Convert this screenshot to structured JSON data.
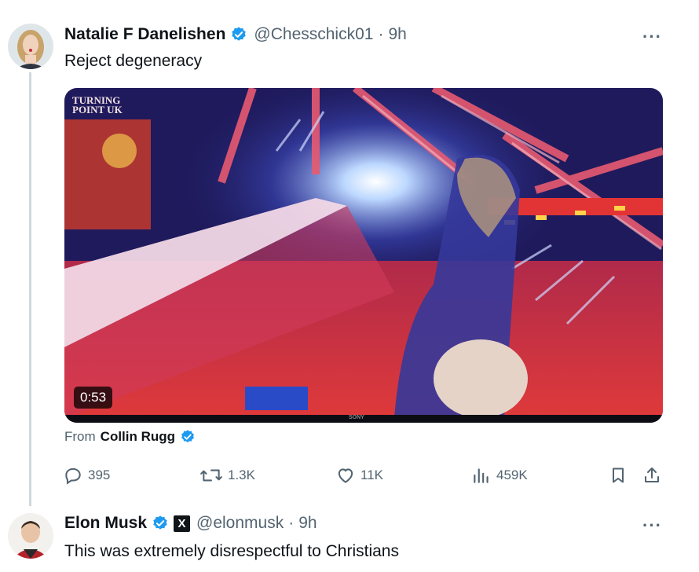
{
  "tweet1": {
    "name": "Natalie F Danelishen",
    "handle": "@Chesschick01",
    "dot": "·",
    "time": "9h",
    "text": "Reject degeneracy",
    "video": {
      "duration": "0:53",
      "watermark_line1": "TURNING",
      "watermark_line2": "POINT UK",
      "camera_mark": "SONY"
    },
    "from_label": "From",
    "from_name": "Collin Rugg",
    "actions": {
      "replies": "395",
      "reposts": "1.3K",
      "likes": "11K",
      "views": "459K"
    }
  },
  "tweet2": {
    "name": "Elon Musk",
    "affiliate_badge": "X",
    "handle": "@elonmusk",
    "dot": "·",
    "time": "9h",
    "text": "This was extremely disrespectful to Christians"
  },
  "more_label": "···",
  "colors": {
    "verified_blue": "#1d9bf0",
    "text_secondary": "#536471",
    "thread_line": "#cfd9de"
  }
}
